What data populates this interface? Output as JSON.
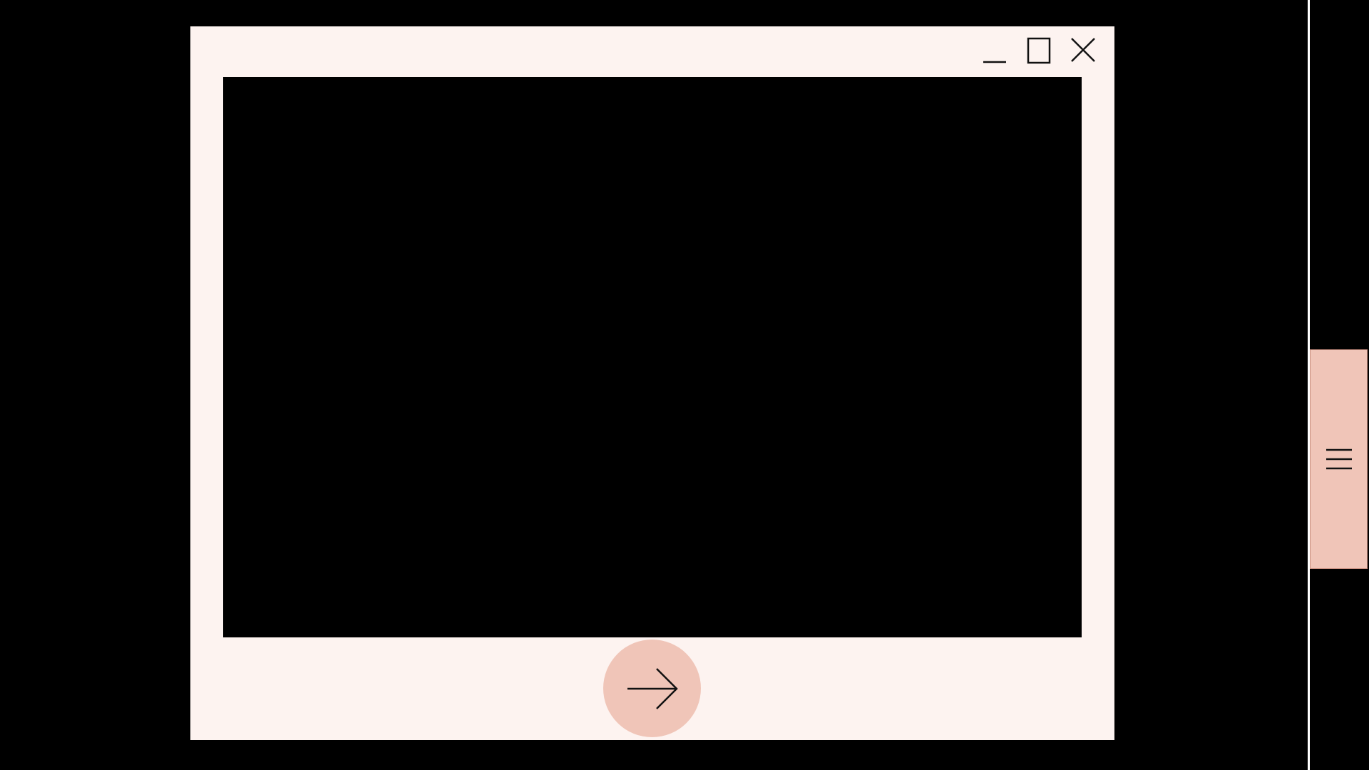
{
  "window": {
    "controls": [
      {
        "name": "minimize",
        "icon": "minimize-icon"
      },
      {
        "name": "maximize",
        "icon": "maximize-icon"
      },
      {
        "name": "close",
        "icon": "close-icon"
      }
    ],
    "content": "blank"
  },
  "navigation": {
    "next_icon": "arrow-right-icon"
  },
  "side_panel": {
    "menu_icon": "hamburger-menu-icon"
  },
  "colors": {
    "background": "#000000",
    "window": "#fdf3f0",
    "accent": "#f0c5b8",
    "icon_stroke": "#111111"
  }
}
